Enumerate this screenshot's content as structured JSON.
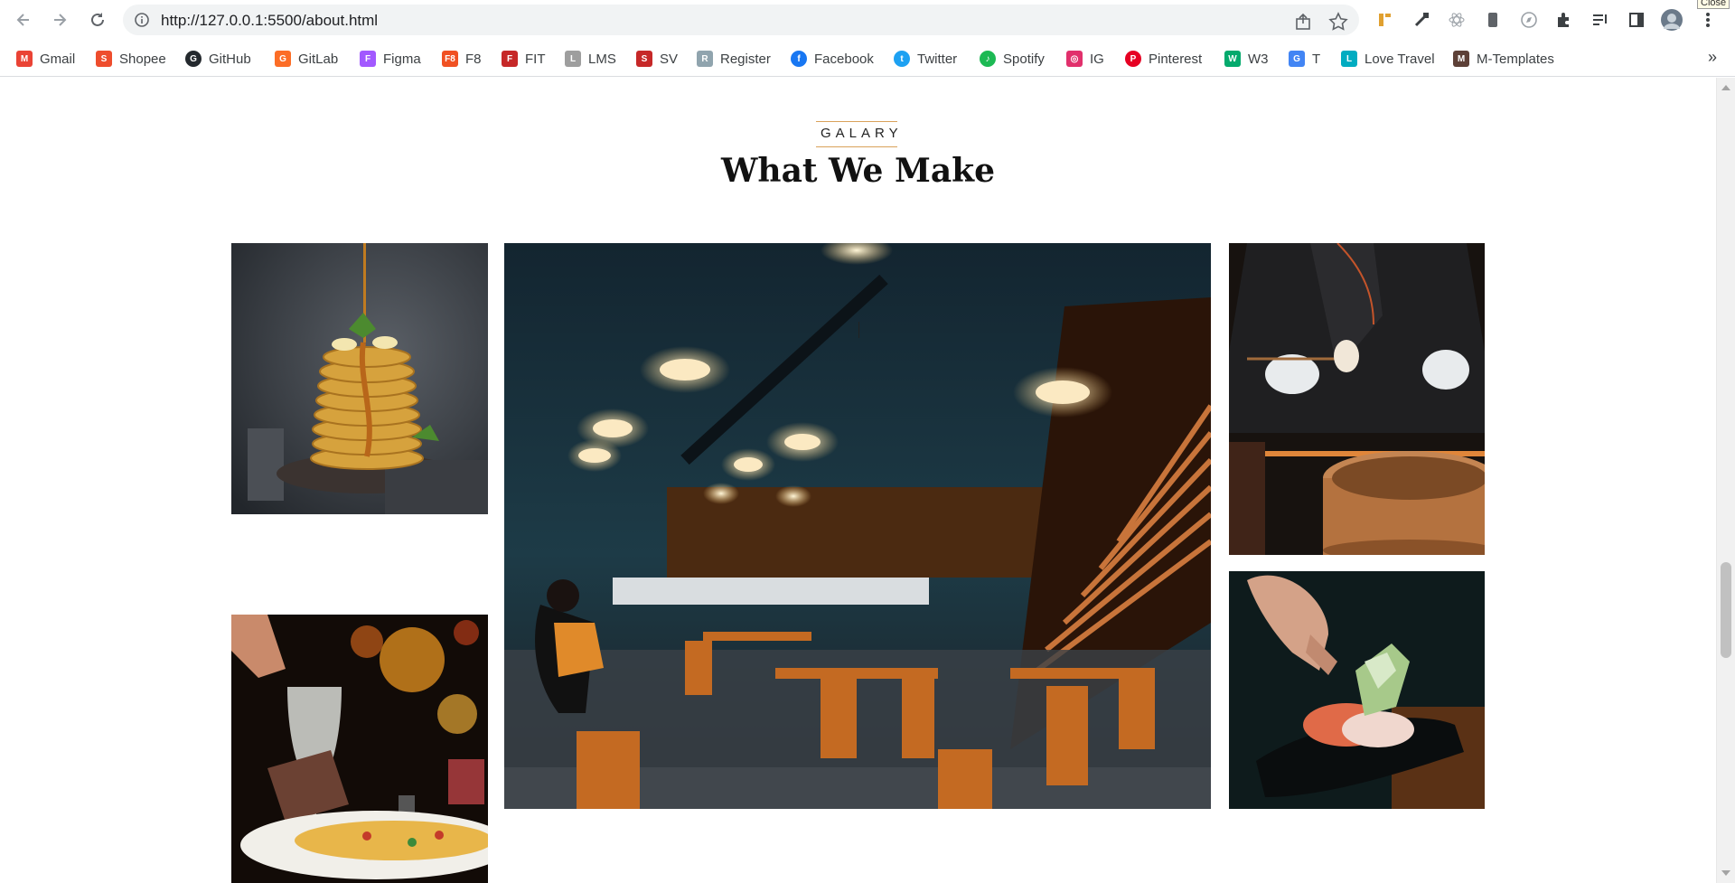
{
  "browser": {
    "url": "http://127.0.0.1:5500/about.html",
    "bookmarks": [
      {
        "label": "Gmail",
        "icon": "gmail-icon",
        "color": "#ea4335"
      },
      {
        "label": "Shopee",
        "icon": "shopee-icon",
        "color": "#ee4d2d"
      },
      {
        "label": "GitHub",
        "icon": "github-icon",
        "color": "#24292e"
      },
      {
        "label": "GitLab",
        "icon": "gitlab-icon",
        "color": "#fc6d26"
      },
      {
        "label": "Figma",
        "icon": "figma-icon",
        "color": "#a259ff"
      },
      {
        "label": "F8",
        "icon": "f8-icon",
        "color": "#f05123"
      },
      {
        "label": "FIT",
        "icon": "fit-icon",
        "color": "#c62828"
      },
      {
        "label": "LMS",
        "icon": "lms-icon",
        "color": "#9e9e9e"
      },
      {
        "label": "SV",
        "icon": "sv-icon",
        "color": "#c62828"
      },
      {
        "label": "Register",
        "icon": "register-icon",
        "color": "#90a4ae"
      },
      {
        "label": "Facebook",
        "icon": "facebook-icon",
        "color": "#1877f2"
      },
      {
        "label": "Twitter",
        "icon": "twitter-icon",
        "color": "#1da1f2"
      },
      {
        "label": "Spotify",
        "icon": "spotify-icon",
        "color": "#1db954"
      },
      {
        "label": "IG",
        "icon": "instagram-icon",
        "color": "#e1306c"
      },
      {
        "label": "Pinterest",
        "icon": "pinterest-icon",
        "color": "#e60023"
      },
      {
        "label": "W3",
        "icon": "w3-icon",
        "color": "#04aa6d"
      },
      {
        "label": "T",
        "icon": "translate-icon",
        "color": "#4285f4"
      },
      {
        "label": "Love Travel",
        "icon": "love-travel-icon",
        "color": "#00acc1"
      },
      {
        "label": "M-Templates",
        "icon": "m-templates-icon",
        "color": "#5d4037"
      }
    ],
    "more_bookmarks": "»",
    "tooltip": "Close"
  },
  "section": {
    "eyebrow": "GALARY",
    "title": "What We Make",
    "accent_color": "#d9a25a"
  },
  "gallery": [
    {
      "name": "pancakes-photo"
    },
    {
      "name": "cocktail-dinner-photo"
    },
    {
      "name": "restaurant-interior-photo"
    },
    {
      "name": "chef-dumplings-photo"
    },
    {
      "name": "sushi-plating-photo"
    }
  ]
}
